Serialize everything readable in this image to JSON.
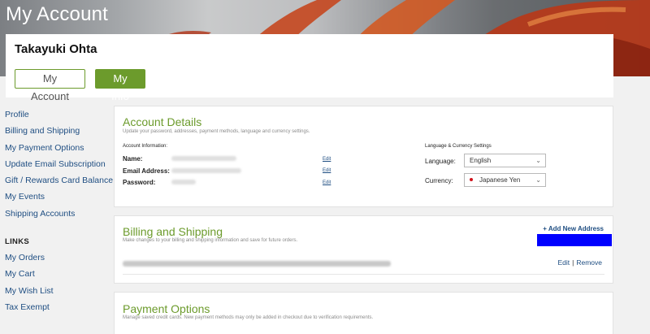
{
  "hero": {
    "title": "My Account"
  },
  "user": {
    "name": "Takayuki Ohta",
    "tabs": [
      "My Account",
      "My Info"
    ]
  },
  "sidebar": {
    "items": [
      "Profile",
      "Billing and Shipping",
      "My Payment Options",
      "Update Email Subscription",
      "Gift / Rewards Card Balance",
      "My Events",
      "Shipping Accounts"
    ],
    "links_heading": "LINKS",
    "links": [
      "My Orders",
      "My Cart",
      "My Wish List",
      "Tax Exempt"
    ]
  },
  "account_details": {
    "title": "Account Details",
    "subtitle": "Update your password, addresses, payment methods, language and currency settings.",
    "info_heading": "Account Information:",
    "fields": [
      {
        "label": "Name:",
        "edit": "Edit"
      },
      {
        "label": "Email Address:",
        "edit": "Edit"
      },
      {
        "label": "Password:",
        "edit": "Edit"
      }
    ],
    "settings_heading": "Language & Currency Settings",
    "language_label": "Language:",
    "language_value": "English",
    "currency_label": "Currency:",
    "currency_value": "Japanese Yen"
  },
  "billing": {
    "title": "Billing and Shipping",
    "subtitle": "Make changes to your billing and shipping information and save for future orders.",
    "add_address": "+ Add New Address",
    "edit": "Edit",
    "separator": "|",
    "remove": "Remove"
  },
  "payment": {
    "title": "Payment Options",
    "subtitle": "Manage saved credit cards. New payment methods may only be added in checkout due to verification requirements."
  },
  "colors": {
    "accent_green": "#6c9b2c",
    "link_blue": "#1f4e82",
    "highlight_blue": "#0000ff"
  }
}
